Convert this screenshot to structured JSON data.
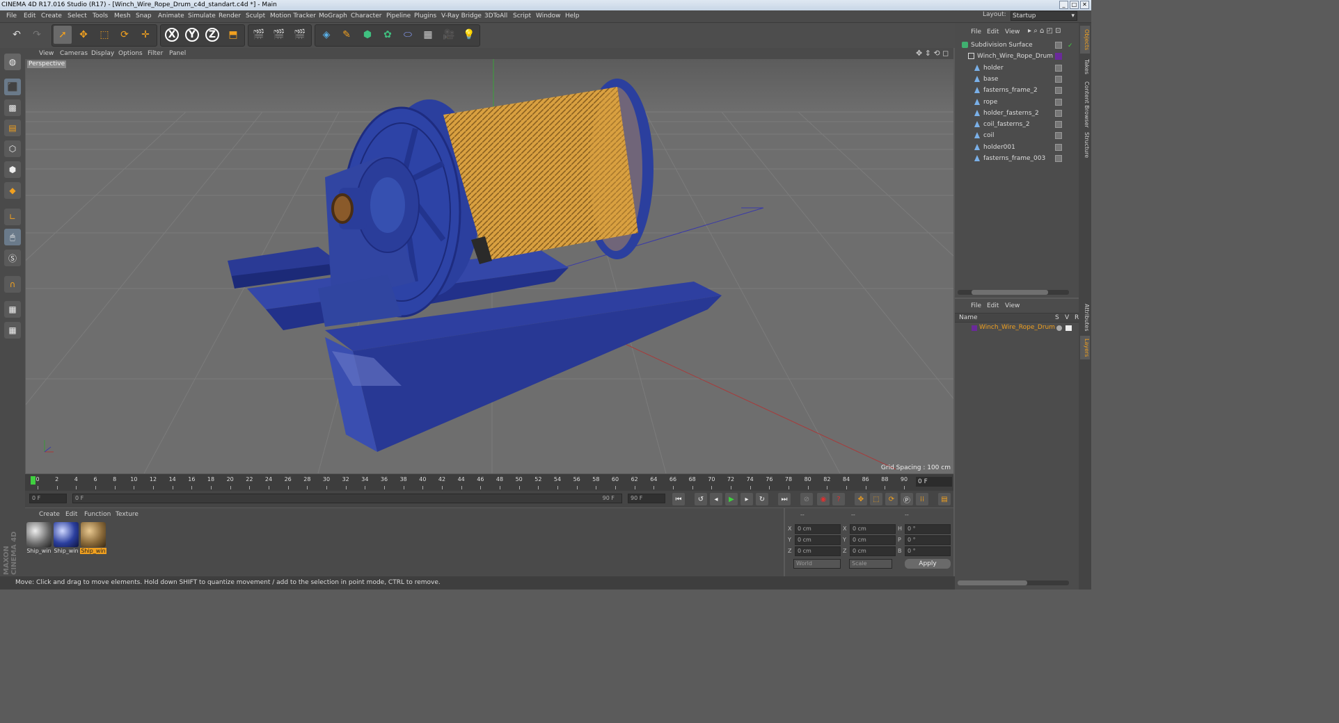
{
  "window": {
    "title": "CINEMA 4D R17.016 Studio (R17) - [Winch_Wire_Rope_Drum_c4d_standart.c4d *] - Main",
    "controls": [
      "_",
      "□",
      "✕"
    ]
  },
  "menu": [
    "File",
    "Edit",
    "Create",
    "Select",
    "Tools",
    "Mesh",
    "Snap",
    "Animate",
    "Simulate",
    "Render",
    "Sculpt",
    "Motion Tracker",
    "MoGraph",
    "Character",
    "Pipeline",
    "Plugins",
    "V-Ray Bridge",
    "3DToAll",
    "Script",
    "Window",
    "Help"
  ],
  "layout": {
    "label": "Layout:",
    "value": "Startup"
  },
  "toolbar": {
    "axis_labels": [
      "X",
      "Y",
      "Z"
    ]
  },
  "viewport": {
    "menu": [
      "View",
      "Cameras",
      "Display",
      "Options",
      "Filter",
      "Panel"
    ],
    "camera_label": "Perspective",
    "grid_spacing": "Grid Spacing : 100 cm"
  },
  "timeline": {
    "ticks": [
      "0",
      "2",
      "4",
      "6",
      "8",
      "10",
      "12",
      "14",
      "16",
      "18",
      "20",
      "22",
      "24",
      "26",
      "28",
      "30",
      "32",
      "34",
      "36",
      "38",
      "40",
      "42",
      "44",
      "46",
      "48",
      "50",
      "52",
      "54",
      "56",
      "58",
      "60",
      "62",
      "64",
      "66",
      "68",
      "70",
      "72",
      "74",
      "76",
      "78",
      "80",
      "82",
      "84",
      "86",
      "88",
      "90"
    ],
    "current_frame": "0 F"
  },
  "transport": {
    "start_field": "0 F",
    "range_start": "0 F",
    "range_end": "90 F",
    "end_field": "90 F"
  },
  "materials": {
    "menu": [
      "Create",
      "Edit",
      "Function",
      "Texture"
    ],
    "items": [
      {
        "label": "Ship_win",
        "selected": false
      },
      {
        "label": "Ship_win",
        "selected": false
      },
      {
        "label": "Ship_win",
        "selected": true
      }
    ]
  },
  "coords": {
    "header": [
      "--",
      "--",
      "--"
    ],
    "rows": [
      {
        "a": "X",
        "av": "0 cm",
        "b": "X",
        "bv": "0 cm",
        "c": "H",
        "cv": "0 °"
      },
      {
        "a": "Y",
        "av": "0 cm",
        "b": "Y",
        "bv": "0 cm",
        "c": "P",
        "cv": "0 °"
      },
      {
        "a": "Z",
        "av": "0 cm",
        "b": "Z",
        "bv": "0 cm",
        "c": "B",
        "cv": "0 °"
      }
    ],
    "mode": "World",
    "scale": "Scale",
    "apply": "Apply"
  },
  "status": "Move: Click and drag to move elements. Hold down SHIFT to quantize movement / add to the selection in point mode, CTRL to remove.",
  "objects": {
    "menu": [
      "File",
      "Edit",
      "View"
    ],
    "items": [
      {
        "name": "Subdivision Surface",
        "depth": 0,
        "type": "subdiv"
      },
      {
        "name": "Winch_Wire_Rope_Drum",
        "depth": 1,
        "type": "null"
      },
      {
        "name": "holder",
        "depth": 2,
        "type": "poly"
      },
      {
        "name": "base",
        "depth": 2,
        "type": "poly"
      },
      {
        "name": "fasterns_frame_2",
        "depth": 2,
        "type": "poly"
      },
      {
        "name": "rope",
        "depth": 2,
        "type": "poly"
      },
      {
        "name": "holder_fasterns_2",
        "depth": 2,
        "type": "poly"
      },
      {
        "name": "coil_fasterns_2",
        "depth": 2,
        "type": "poly"
      },
      {
        "name": "coil",
        "depth": 2,
        "type": "poly"
      },
      {
        "name": "holder001",
        "depth": 2,
        "type": "poly"
      },
      {
        "name": "fasterns_frame_003",
        "depth": 2,
        "type": "poly"
      }
    ]
  },
  "layers": {
    "menu": [
      "File",
      "Edit",
      "View"
    ],
    "columns": [
      "Name",
      "S",
      "V",
      "R"
    ],
    "items": [
      {
        "name": "Winch_Wire_Rope_Drum"
      }
    ]
  },
  "side_tabs": [
    "Objects",
    "Takes",
    "Content Browser",
    "Structure",
    "Attributes",
    "Layers"
  ],
  "brand": "MAXON CINEMA 4D",
  "colors": {
    "accent": "#f0a020",
    "selection": "#f0a020",
    "layer_name": "#f0a020",
    "model_blue": "#2b3f9e",
    "rope": "#e0a640"
  }
}
